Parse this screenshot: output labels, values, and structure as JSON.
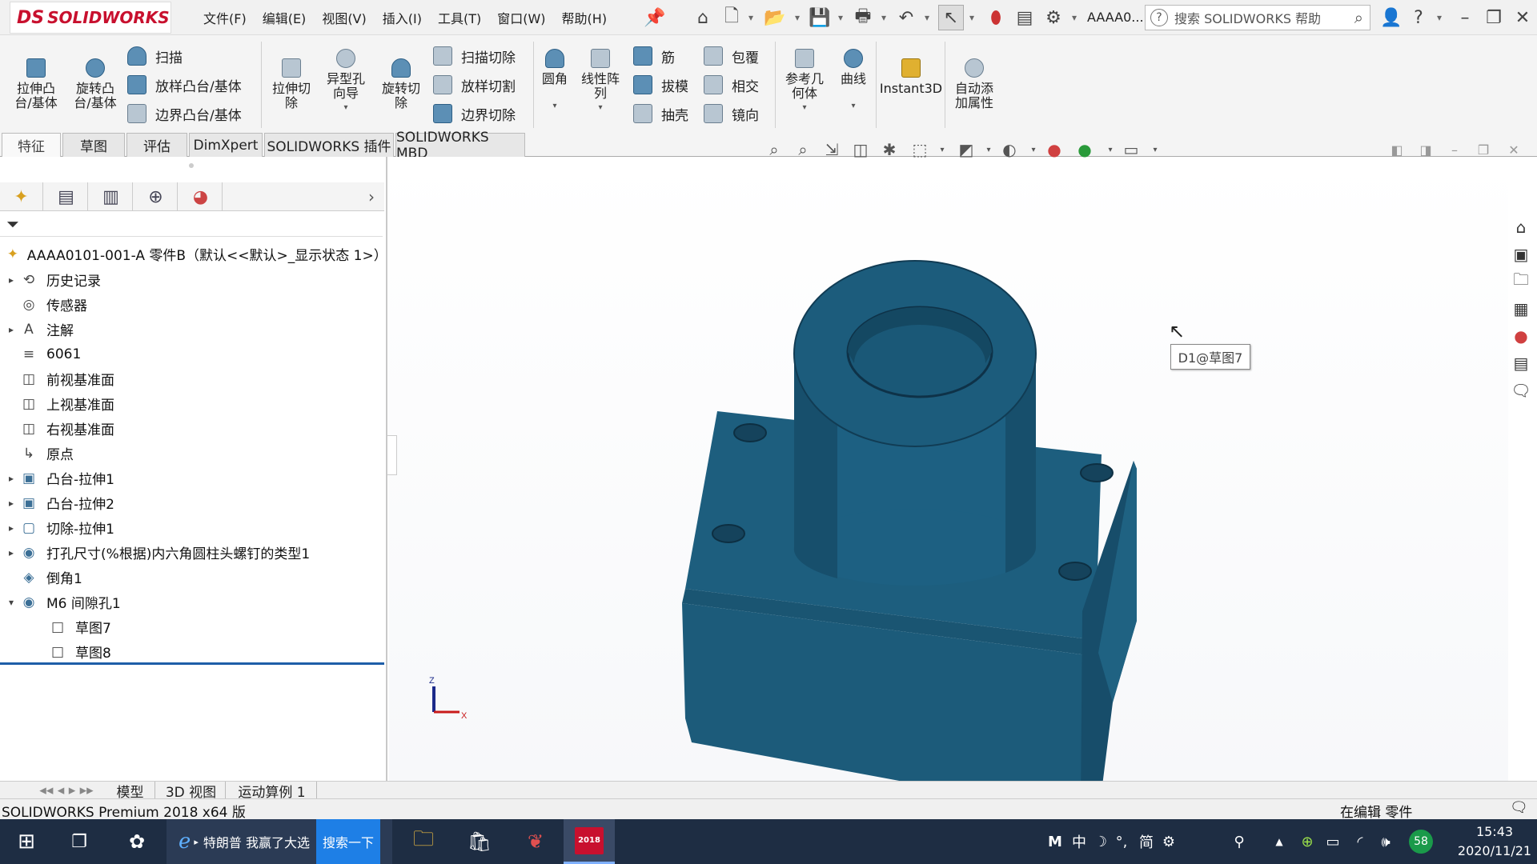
{
  "app": {
    "logo": {
      "mark": "DS",
      "name": "SOLIDWORKS"
    },
    "menu": [
      "文件(F)",
      "编辑(E)",
      "视图(V)",
      "插入(I)",
      "工具(T)",
      "窗口(W)",
      "帮助(H)"
    ],
    "doc_short": "AAAA0...",
    "search_placeholder": "搜索 SOLIDWORKS 帮助"
  },
  "ribbon": {
    "extrude_boss": "拉伸凸\n台/基体",
    "revolve_boss": "旋转凸\n台/基体",
    "sweep": "扫描",
    "loft": "放样凸台/基体",
    "boundary": "边界凸台/基体",
    "extrude_cut": "拉伸切\n除",
    "hole_wizard": "异型孔\n向导",
    "revolve_cut": "旋转切\n除",
    "swept_cut": "扫描切除",
    "lofted_cut": "放样切割",
    "boundary_cut": "边界切除",
    "fillet": "圆角",
    "linear_pattern": "线性阵\n列",
    "rib": "筋",
    "draft": "拔模",
    "shell": "抽壳",
    "wrap": "包覆",
    "intersect": "相交",
    "mirror": "镜向",
    "ref_geometry": "参考几\n何体",
    "curves": "曲线",
    "instant3d": "Instant3D",
    "auto_attr": "自动添\n加属性"
  },
  "tabs": [
    "特征",
    "草图",
    "评估",
    "DimXpert",
    "SOLIDWORKS 插件",
    "SOLIDWORKS MBD"
  ],
  "tree": {
    "root": "AAAA0101-001-A 零件B（默认<<默认>_显示状态 1>）",
    "items": [
      {
        "label": "历史记录",
        "expand": "▸",
        "icon": "history-icon"
      },
      {
        "label": "传感器",
        "expand": "",
        "icon": "sensor-icon"
      },
      {
        "label": "注解",
        "expand": "▸",
        "icon": "annotation-icon"
      },
      {
        "label": "6061",
        "expand": "",
        "icon": "material-icon"
      },
      {
        "label": "前视基准面",
        "expand": "",
        "icon": "plane-icon"
      },
      {
        "label": "上视基准面",
        "expand": "",
        "icon": "plane-icon"
      },
      {
        "label": "右视基准面",
        "expand": "",
        "icon": "plane-icon"
      },
      {
        "label": "原点",
        "expand": "",
        "icon": "origin-icon"
      },
      {
        "label": "凸台-拉伸1",
        "expand": "▸",
        "icon": "extrude-icon"
      },
      {
        "label": "凸台-拉伸2",
        "expand": "▸",
        "icon": "extrude-icon"
      },
      {
        "label": "切除-拉伸1",
        "expand": "▸",
        "icon": "cut-icon"
      },
      {
        "label": "打孔尺寸(%根据)内六角圆柱头螺钉的类型1",
        "expand": "▸",
        "icon": "hole-icon"
      },
      {
        "label": "倒角1",
        "expand": "",
        "icon": "chamfer-icon"
      },
      {
        "label": "M6 间隙孔1",
        "expand": "▾",
        "icon": "hole-icon"
      },
      {
        "label": "草图7",
        "expand": "",
        "icon": "sketch-icon"
      },
      {
        "label": "草图8",
        "expand": "",
        "icon": "sketch-icon"
      }
    ]
  },
  "model_tabs": [
    "模型",
    "3D 视图",
    "运动算例 1"
  ],
  "status": {
    "left": "SOLIDWORKS Premium 2018 x64 版",
    "right": "在编辑 零件"
  },
  "viewport": {
    "tooltip": "D1@草图7",
    "axis_x": "X",
    "axis_z": "Z",
    "part_color": "#1c5c7c"
  },
  "taskbar": {
    "ie_text": "特朗普 我赢了大选",
    "search_btn": "搜索一下",
    "sw_label": "2018",
    "tray_time": "15:43",
    "tray_date": "2020/11/21",
    "tray_badge": "58",
    "ime": [
      "M",
      "中",
      "简"
    ]
  }
}
